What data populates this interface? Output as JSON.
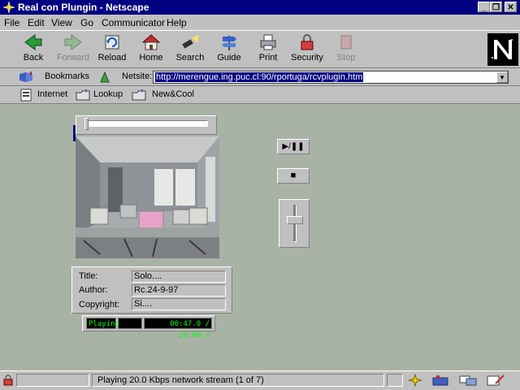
{
  "window": {
    "title": "Real con Plungin - Netscape"
  },
  "menu": [
    {
      "label": "File"
    },
    {
      "label": "Edit"
    },
    {
      "label": "View"
    },
    {
      "label": "Go"
    },
    {
      "label": "Communicator"
    },
    {
      "label": "Help"
    }
  ],
  "toolbar": {
    "back": "Back",
    "forward": "Forward",
    "reload": "Reload",
    "home": "Home",
    "search": "Search",
    "guide": "Guide",
    "print": "Print",
    "security": "Security",
    "stop": "Stop"
  },
  "location": {
    "bookmarks": "Bookmarks",
    "netsite_label": "Netsite:",
    "url": "http://merengue.ing.puc.cl:90/rportuga/rcvplugin.htm"
  },
  "personal": {
    "internet": "Internet",
    "lookup": "Lookup",
    "newcool": "New&Cool"
  },
  "player": {
    "title_label": "Title:",
    "title_value": "Solo....",
    "author_label": "Author:",
    "author_value": "Rc.24-9-97",
    "copyright_label": "Copyright:",
    "copyright_value": "Si....",
    "status": "Playing",
    "time": "00:47.0 / 25:09.7",
    "play_pause_symbol": "▶/❚❚",
    "stop_symbol": "■"
  },
  "status": {
    "text": "Playing 20.0 Kbps network stream (1 of 7)"
  }
}
